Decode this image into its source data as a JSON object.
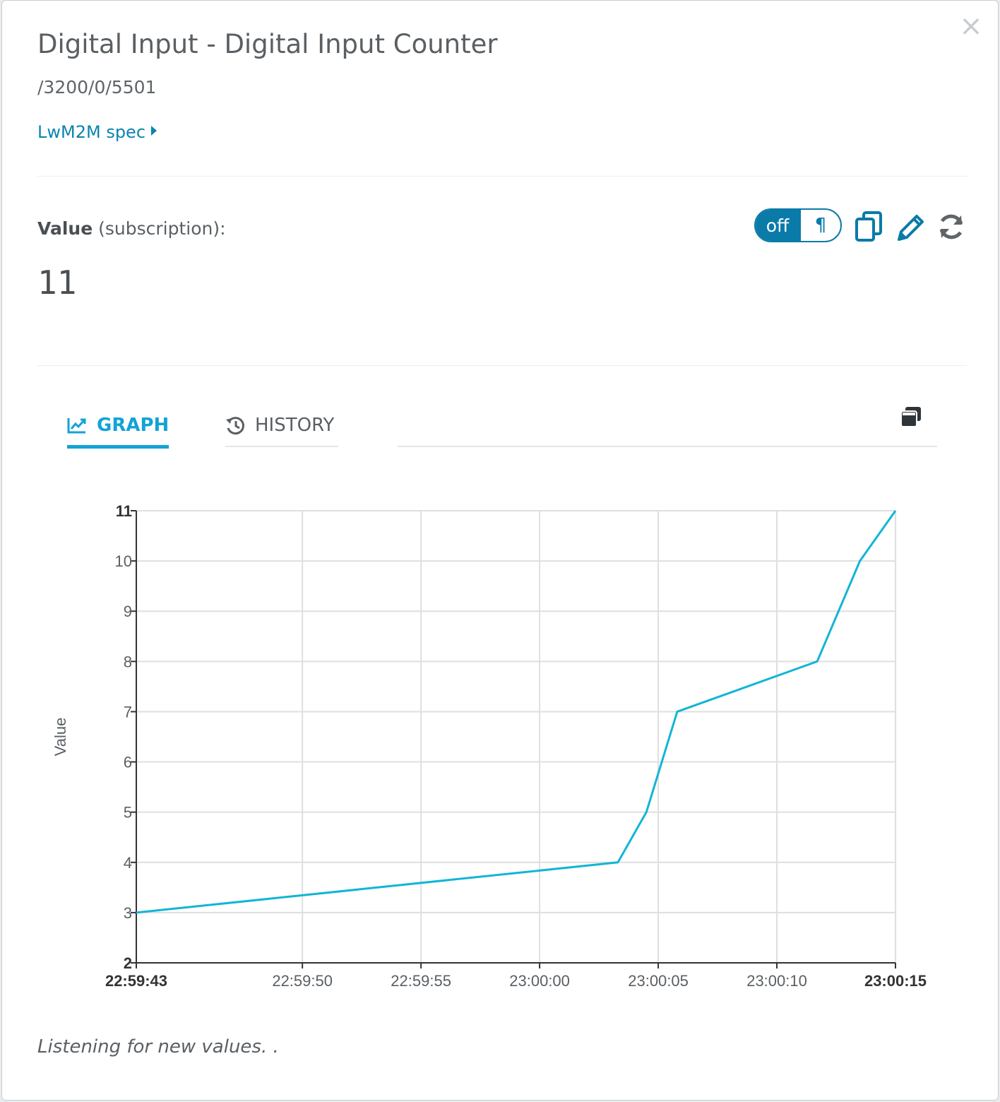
{
  "modal": {
    "title": "Digital Input - Digital Input Counter",
    "path": "/3200/0/5501",
    "spec_link": "LwM2M spec"
  },
  "value": {
    "label_bold": "Value",
    "label_rest": " (subscription):",
    "current": "11"
  },
  "toolbar": {
    "toggle_off": "off",
    "toggle_symbol": "¶",
    "icons": [
      "copy-icon",
      "pencil-icon",
      "refresh-icon"
    ]
  },
  "tabs": [
    {
      "label": "GRAPH",
      "icon": "line-chart-icon",
      "active": true
    },
    {
      "label": "HISTORY",
      "icon": "history-icon",
      "active": false
    }
  ],
  "status": "Listening for new values. .",
  "colors": {
    "accent": "#12a3d6",
    "link": "#0a84b0",
    "toggle": "#0a7aa8",
    "line": "#12b5d6"
  },
  "chart_data": {
    "type": "line",
    "title": "",
    "xlabel": "",
    "ylabel": "Value",
    "ylim": [
      2,
      11
    ],
    "xlim": [
      "22:59:43",
      "23:00:15"
    ],
    "yticks": [
      2,
      3,
      4,
      5,
      6,
      7,
      8,
      9,
      10,
      11
    ],
    "xticks": [
      "22:59:43",
      "22:59:50",
      "22:59:55",
      "23:00:00",
      "23:00:05",
      "23:00:10",
      "23:00:15"
    ],
    "bold_ticks": [
      "22:59:43",
      "23:00:15",
      "11",
      "2"
    ],
    "grid": true,
    "series": [
      {
        "x": [
          "22:59:43",
          "23:00:03.3",
          "23:00:04.5",
          "23:00:05.8",
          "23:00:11.7",
          "23:00:13.5",
          "23:00:15"
        ],
        "y": [
          3,
          4,
          5,
          7,
          8,
          10,
          11
        ]
      }
    ]
  }
}
